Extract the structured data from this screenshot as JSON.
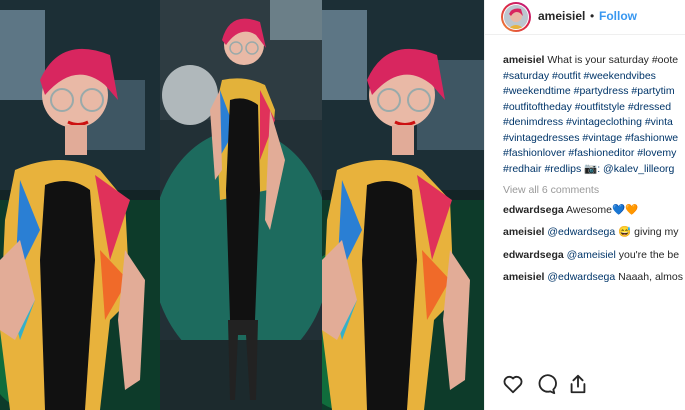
{
  "post": {
    "username": "ameisiel",
    "follow_label": "Follow",
    "separator": "•",
    "caption_user": "ameisiel",
    "caption_lines": [
      "What is your saturday #oote",
      "#saturday #outfit #weekendvibes",
      "#weekendtime #partydress #partytim",
      "#outfitoftheday #outfitstyle #dressed",
      "#denimdress #vintageclothing #vinta",
      "#vintagedresses #vintage #fashionwe",
      "#fashionlover #fashioneditor #lovemy",
      "#redhair #redlips 📷: @kalev_lilleorg"
    ],
    "view_all": "View all 6 comments",
    "comments": [
      {
        "user": "edwardsega",
        "text": "Awesome💙🧡"
      },
      {
        "user": "ameisiel",
        "mention": "@edwardsega",
        "text": "😅 giving my"
      },
      {
        "user": "edwardsega",
        "mention": "@ameisiel",
        "text": "you're the be"
      },
      {
        "user": "ameisiel",
        "mention": "@edwardsega",
        "text": "Naaah, almos"
      }
    ]
  },
  "icons": [
    "heart-icon",
    "comment-icon",
    "share-icon"
  ],
  "colors": {
    "follow": "#3897f0",
    "hashtag": "#003569",
    "muted": "#999999",
    "text": "#262626"
  }
}
